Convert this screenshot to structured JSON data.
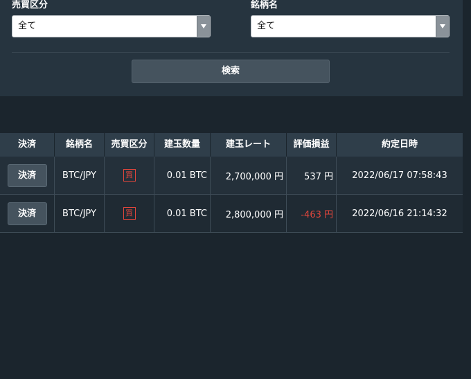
{
  "filters": {
    "side_label": "売買区分",
    "side_value": "全て",
    "symbol_label": "銘柄名",
    "symbol_value": "全て",
    "search_label": "検索"
  },
  "table": {
    "headers": [
      "決済",
      "銘柄名",
      "売買区分",
      "建玉数量",
      "建玉レート",
      "評価損益",
      "約定日時"
    ],
    "rows": [
      {
        "action": "決済",
        "symbol": "BTC/JPY",
        "side": "買",
        "quantity": "0.01 BTC",
        "rate": "2,700,000 円",
        "pnl": "537 円",
        "datetime": "2022/06/17 07:58:43"
      },
      {
        "action": "決済",
        "symbol": "BTC/JPY",
        "side": "買",
        "quantity": "0.01 BTC",
        "rate": "2,800,000 円",
        "pnl": "-463 円",
        "datetime": "2022/06/16 21:14:32"
      }
    ]
  },
  "colors": {
    "background": "#1b252d",
    "panel": "#26343f",
    "negative": "#e0463c",
    "buy_badge": "#e0463c"
  },
  "icons": {
    "select_arrow": "chevron-down-icon"
  }
}
